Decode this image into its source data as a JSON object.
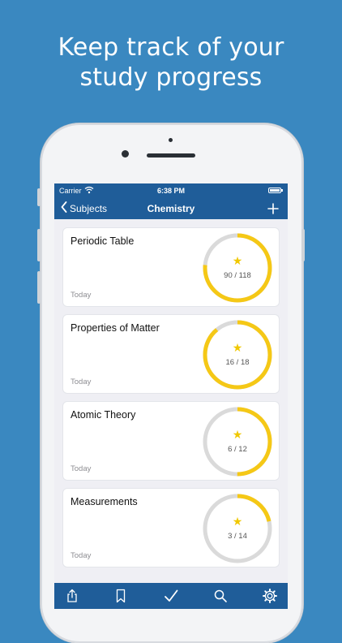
{
  "promo": {
    "line1": "Keep track of your",
    "line2": "study progress"
  },
  "status": {
    "carrier": "Carrier",
    "time": "6:38 PM"
  },
  "nav": {
    "back_label": "Subjects",
    "title": "Chemistry",
    "add_icon": "plus-icon"
  },
  "colors": {
    "background": "#3a88c0",
    "bar": "#1f5d99",
    "ring_progress": "#f5c816",
    "ring_track": "#dadada"
  },
  "topics": [
    {
      "name": "Periodic Table",
      "date": "Today",
      "count": "90 / 118",
      "progress": 0.763
    },
    {
      "name": "Properties of Matter",
      "date": "Today",
      "count": "16 / 18",
      "progress": 0.889
    },
    {
      "name": "Atomic Theory",
      "date": "Today",
      "count": "6 / 12",
      "progress": 0.5
    },
    {
      "name": "Measurements",
      "date": "Today",
      "count": "3 / 14",
      "progress": 0.214
    }
  ],
  "tabbar": {
    "icons": [
      "share-icon",
      "bookmark-icon",
      "checkmark-icon",
      "search-icon",
      "gear-icon"
    ]
  }
}
